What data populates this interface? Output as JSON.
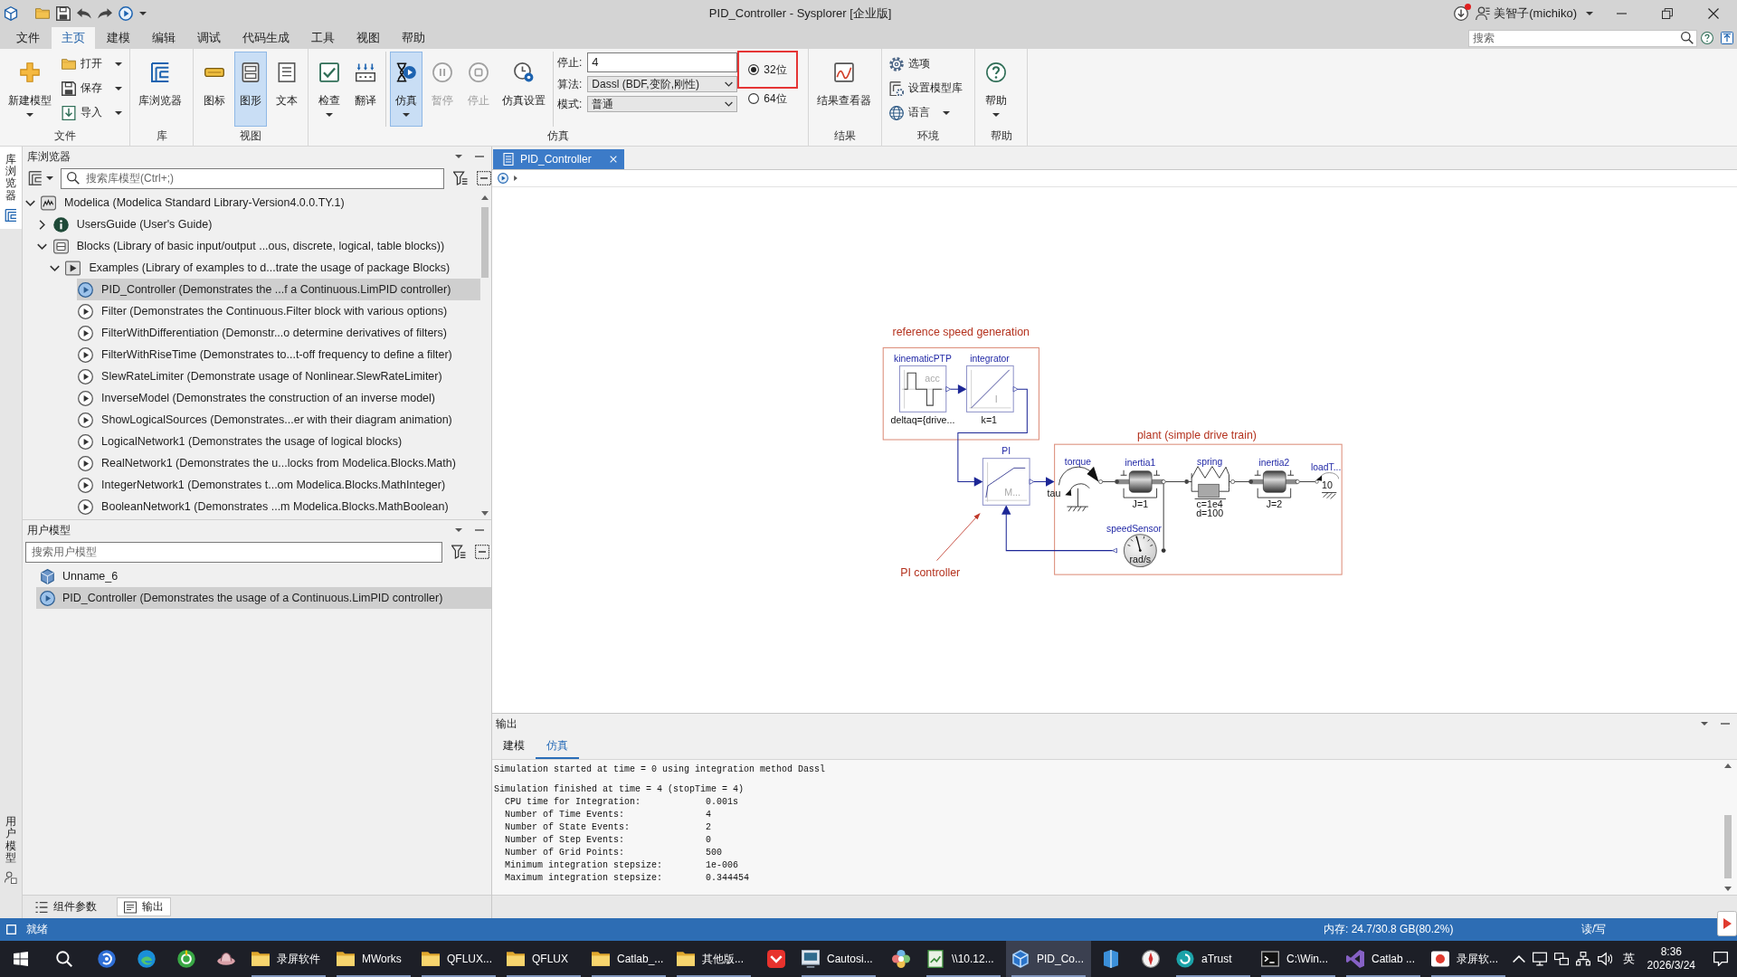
{
  "window": {
    "title": "PID_Controller - Sysplorer [企业版]",
    "user": "美智子(michiko)",
    "update_notice": true
  },
  "menu": [
    {
      "label": "文件",
      "selected": false
    },
    {
      "label": "主页",
      "selected": true
    },
    {
      "label": "建模",
      "selected": false
    },
    {
      "label": "编辑",
      "selected": false
    },
    {
      "label": "调试",
      "selected": false
    },
    {
      "label": "代码生成",
      "selected": false
    },
    {
      "label": "工具",
      "selected": false
    },
    {
      "label": "视图",
      "selected": false
    },
    {
      "label": "帮助",
      "selected": false
    }
  ],
  "search": {
    "placeholder": "搜索"
  },
  "ribbon": {
    "groups": [
      {
        "label": "文件",
        "items": [
          {
            "kind": "large",
            "label": "新建模型",
            "dropdown": true,
            "selected": false,
            "disabled": false
          },
          {
            "kind": "stack",
            "buttons": [
              {
                "label": "打开",
                "dropdown": true
              },
              {
                "label": "保存",
                "dropdown": true
              },
              {
                "label": "导入",
                "dropdown": true
              }
            ]
          }
        ]
      },
      {
        "label": "库",
        "items": [
          {
            "kind": "large",
            "label": "库浏览器",
            "dropdown": false,
            "selected": false,
            "disabled": false
          }
        ]
      },
      {
        "label": "视图",
        "items": [
          {
            "kind": "large",
            "label": "图标",
            "dropdown": false,
            "selected": false,
            "disabled": false
          },
          {
            "kind": "large",
            "label": "图形",
            "dropdown": false,
            "selected": true,
            "disabled": false
          },
          {
            "kind": "large",
            "label": "文本",
            "dropdown": false,
            "selected": false,
            "disabled": false
          }
        ]
      },
      {
        "label": "仿真",
        "items": [
          {
            "kind": "large",
            "label": "检查",
            "dropdown": true,
            "selected": false,
            "disabled": false
          },
          {
            "kind": "large",
            "label": "翻译",
            "dropdown": false,
            "selected": false,
            "disabled": false
          },
          {
            "kind": "large",
            "label": "仿真",
            "dropdown": true,
            "selected": true,
            "disabled": false,
            "divider_before": true
          },
          {
            "kind": "large",
            "label": "暂停",
            "dropdown": false,
            "selected": false,
            "disabled": true
          },
          {
            "kind": "large",
            "label": "停止",
            "dropdown": false,
            "selected": false,
            "disabled": true
          },
          {
            "kind": "large",
            "label": "仿真设置",
            "dropdown": false,
            "selected": false,
            "disabled": false
          },
          {
            "kind": "form",
            "divider_before": true,
            "fields": [
              {
                "kind": "input",
                "label": "停止:",
                "value": "4"
              },
              {
                "kind": "select",
                "label": "算法:",
                "value": "Dassl (BDF,变阶,刚性)"
              },
              {
                "kind": "select",
                "label": "模式:",
                "value": "普通"
              }
            ]
          },
          {
            "kind": "radios",
            "options": [
              {
                "label": "32位",
                "selected": true,
                "highlighted": true
              },
              {
                "label": "64位",
                "selected": false,
                "highlighted": false
              }
            ]
          }
        ]
      },
      {
        "label": "结果",
        "items": [
          {
            "kind": "large",
            "label": "结果查看器",
            "dropdown": false,
            "selected": false,
            "disabled": false
          }
        ]
      },
      {
        "label": "环境",
        "items": [
          {
            "kind": "stack",
            "buttons": [
              {
                "label": "选项",
                "dropdown": false
              },
              {
                "label": "设置模型库",
                "dropdown": false
              },
              {
                "label": "语言",
                "dropdown": true
              }
            ]
          }
        ]
      },
      {
        "label": "帮助",
        "items": [
          {
            "kind": "large",
            "label": "帮助",
            "dropdown": true,
            "selected": false,
            "disabled": false
          }
        ]
      }
    ]
  },
  "side_tabs": [
    {
      "label": "库浏览器",
      "selected": true
    },
    {
      "label": "用户模型",
      "selected": false
    }
  ],
  "library_browser": {
    "title": "库浏览器",
    "search_placeholder": "搜索库模型(Ctrl+;)",
    "tree": [
      {
        "label": "Modelica (Modelica Standard Library-Version4.0.0.TY.1)",
        "kind": "library",
        "expanded": true,
        "selected": false,
        "children": [
          {
            "label": "UsersGuide (User's Guide)",
            "kind": "guide",
            "expanded": false,
            "selected": false
          },
          {
            "label": "Blocks (Library of basic input/output ...ous, discrete, logical, table blocks))",
            "kind": "package",
            "expanded": true,
            "selected": false,
            "children": [
              {
                "label": "Examples (Library of examples to d...trate the usage of package Blocks)",
                "kind": "examples",
                "expanded": true,
                "selected": false,
                "children": [
                  {
                    "label": "PID_Controller (Demonstrates the ...f a Continuous.LimPID controller)",
                    "kind": "example",
                    "selected": true
                  },
                  {
                    "label": "Filter (Demonstrates the Continuous.Filter block with various options)",
                    "kind": "example",
                    "selected": false
                  },
                  {
                    "label": "FilterWithDifferentiation (Demonstr...o determine derivatives of filters)",
                    "kind": "example",
                    "selected": false
                  },
                  {
                    "label": "FilterWithRiseTime (Demonstrates to...t-off frequency to define a filter)",
                    "kind": "example",
                    "selected": false
                  },
                  {
                    "label": "SlewRateLimiter (Demonstrate usage of Nonlinear.SlewRateLimiter)",
                    "kind": "example",
                    "selected": false
                  },
                  {
                    "label": "InverseModel (Demonstrates the construction of an inverse model)",
                    "kind": "example",
                    "selected": false
                  },
                  {
                    "label": "ShowLogicalSources (Demonstrates...er with their diagram animation)",
                    "kind": "example",
                    "selected": false
                  },
                  {
                    "label": "LogicalNetwork1 (Demonstrates the usage of logical blocks)",
                    "kind": "example",
                    "selected": false
                  },
                  {
                    "label": "RealNetwork1 (Demonstrates the u...locks from Modelica.Blocks.Math)",
                    "kind": "example",
                    "selected": false
                  },
                  {
                    "label": "IntegerNetwork1 (Demonstrates t...om Modelica.Blocks.MathInteger)",
                    "kind": "example",
                    "selected": false
                  },
                  {
                    "label": "BooleanNetwork1 (Demonstrates ...m Modelica.Blocks.MathBoolean)",
                    "kind": "example",
                    "selected": false
                  }
                ]
              }
            ]
          }
        ]
      }
    ]
  },
  "user_models": {
    "title": "用户模型",
    "search_placeholder": "搜索用户模型",
    "items": [
      {
        "label": "Unname_6",
        "kind": "model",
        "selected": false
      },
      {
        "label": "PID_Controller (Demonstrates the usage of a Continuous.LimPID controller)",
        "kind": "example",
        "selected": true
      }
    ]
  },
  "panel_tabs": [
    {
      "label": "组件参数",
      "selected": false
    },
    {
      "label": "输出",
      "selected": true
    }
  ],
  "document_tabs": [
    {
      "label": "PID_Controller",
      "selected": true
    }
  ],
  "diagram": {
    "groups": [
      {
        "label": "reference speed generation"
      },
      {
        "label": "plant (simple drive train)"
      }
    ],
    "components": [
      {
        "name": "kinematicPTP",
        "kind": "source",
        "icon_text": "acc",
        "params": [
          "deltaq={drive..."
        ]
      },
      {
        "name": "integrator",
        "kind": "integrator",
        "icon_text": "I",
        "params": [
          "k=1"
        ]
      },
      {
        "name": "PI",
        "kind": "controller",
        "icon_text": "M..."
      },
      {
        "name": "torque",
        "kind": "torque",
        "port_label": "tau"
      },
      {
        "name": "inertia1",
        "kind": "inertia",
        "params": [
          "J=1"
        ]
      },
      {
        "name": "spring",
        "kind": "spring",
        "params": [
          "c=1e4",
          "d=100"
        ]
      },
      {
        "name": "inertia2",
        "kind": "inertia",
        "params": [
          "J=2"
        ]
      },
      {
        "name": "loadT...",
        "kind": "load",
        "params": [
          "10"
        ]
      },
      {
        "name": "speedSensor",
        "kind": "sensor",
        "icon_text": "rad/s"
      }
    ],
    "annotations": [
      {
        "label": "PI controller"
      }
    ]
  },
  "output": {
    "title": "输出",
    "tabs": [
      {
        "label": "建模",
        "selected": false
      },
      {
        "label": "仿真",
        "selected": true
      }
    ],
    "log": {
      "intro": "Simulation started at time = 0 using integration method Dassl",
      "summary": "Simulation finished at time = 4 (stopTime = 4)",
      "stats": [
        {
          "label": "CPU time for Integration:",
          "value": "0.001s"
        },
        {
          "label": "Number of Time Events:",
          "value": "4"
        },
        {
          "label": "Number of State Events:",
          "value": "2"
        },
        {
          "label": "Number of Step Events:",
          "value": "0"
        },
        {
          "label": "Number of Grid Points:",
          "value": "500"
        },
        {
          "label": "Minimum integration stepsize:",
          "value": "1e-006"
        },
        {
          "label": "Maximum integration stepsize:",
          "value": "0.344454"
        }
      ]
    }
  },
  "status_bar": {
    "text": "就绪",
    "memory": "内存: 24.7/30.8 GB(80.2%)",
    "access": "读/写"
  },
  "taskbar": {
    "items": [
      {
        "active": false,
        "running": false
      },
      {
        "active": false,
        "running": false
      },
      {
        "active": false,
        "running": false
      },
      {
        "active": false,
        "running": false
      },
      {
        "label": "录屏软件",
        "active": false,
        "running": true
      },
      {
        "label": "MWorks",
        "active": false,
        "running": true
      },
      {
        "label": "QFLUX...",
        "active": false,
        "running": true
      },
      {
        "label": "QFLUX",
        "active": false,
        "running": true
      },
      {
        "label": "Catlab_...",
        "active": false,
        "running": true
      },
      {
        "label": "其他版...",
        "active": false,
        "running": true
      },
      {
        "active": false,
        "running": false
      },
      {
        "label": "Cautosi...",
        "active": false,
        "running": true
      },
      {
        "active": false,
        "running": false
      },
      {
        "label": "\\\\10.12...",
        "active": false,
        "running": true
      },
      {
        "label": "PID_Co...",
        "active": true,
        "running": true
      },
      {
        "active": false,
        "running": false
      },
      {
        "active": false,
        "running": false
      },
      {
        "label": "aTrust",
        "active": false,
        "running": true
      },
      {
        "label": "C:\\Win...",
        "active": false,
        "running": true
      },
      {
        "label": "Catlab ...",
        "active": false,
        "running": true
      },
      {
        "label": "录屏软...",
        "active": false,
        "running": true
      }
    ],
    "ime": "英",
    "time": "8:36",
    "date": "2026/3/24"
  }
}
